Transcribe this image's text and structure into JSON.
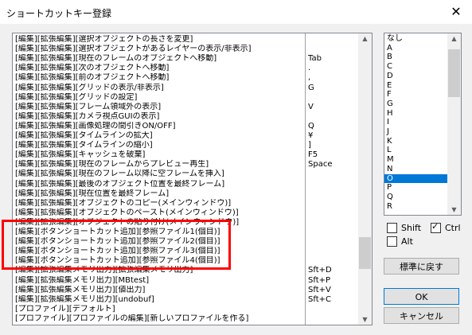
{
  "window": {
    "title": "ショートカットキー登録",
    "close_glyph": "✕"
  },
  "commands": [
    {
      "name": "[編集][拡張編集][選択オブジェクトの長さを変更]",
      "key": ""
    },
    {
      "name": "[編集][拡張編集][選択オブジェクトがあるレイヤーの表示/非表示]",
      "key": ""
    },
    {
      "name": "[編集][拡張編集][現在のフレームのオブジェクトへ移動]",
      "key": "Tab"
    },
    {
      "name": "[編集][拡張編集][次のオブジェクトへ移動]",
      "key": "."
    },
    {
      "name": "[編集][拡張編集][前のオブジェクトへ移動]",
      "key": ","
    },
    {
      "name": "[編集][拡張編集][グリッドの表示/非表示]",
      "key": "G"
    },
    {
      "name": "[編集][拡張編集][グリッドの設定]",
      "key": ""
    },
    {
      "name": "[編集][拡張編集][フレーム領域外の表示]",
      "key": "V"
    },
    {
      "name": "[編集][拡張編集][カメラ視点GUIの表示]",
      "key": ""
    },
    {
      "name": "[編集][拡張編集][画像処理の間引きON/OFF]",
      "key": "Q"
    },
    {
      "name": "[編集][拡張編集][タイムラインの拡大]",
      "key": "¥"
    },
    {
      "name": "[編集][拡張編集][タイムラインの縮小]",
      "key": "]"
    },
    {
      "name": "[編集][拡張編集][キャッシュを破棄]",
      "key": "F5"
    },
    {
      "name": "[編集][拡張編集][現在のフレームからプレビュー再生]",
      "key": "Space"
    },
    {
      "name": "[編集][拡張編集][現在のフレーム以降に空フレームを挿入]",
      "key": ""
    },
    {
      "name": "[編集][拡張編集][最後のオブジェクト位置を最終フレーム]",
      "key": ""
    },
    {
      "name": "[編集][拡張編集][現在位置を最終フレーム]",
      "key": ""
    },
    {
      "name": "[編集][拡張編集][オブジェクトのコピー(メインウィンドウ)]",
      "key": ""
    },
    {
      "name": "[編集][拡張編集][オブジェクトのペースト(メインウィンドウ)]",
      "key": ""
    },
    {
      "name": "[編集][拡張編集][オブジェクトの貼り付け(メインウィンドウ)]",
      "key": ""
    },
    {
      "name": "[編集][ボタンショートカット追加][参照ファイル1(個目)]",
      "key": ""
    },
    {
      "name": "[編集][ボタンショートカット追加][参照ファイル2(個目)]",
      "key": ""
    },
    {
      "name": "[編集][ボタンショートカット追加][参照ファイル3(個目)]",
      "key": ""
    },
    {
      "name": "[編集][ボタンショートカット追加][参照ファイル4(個目)]",
      "key": ""
    },
    {
      "name": "[編集][拡張編集メモリ出力][拡張編集メモリ出力]",
      "key": "Sft+D"
    },
    {
      "name": "[編集][拡張編集メモリ出力][MBtest]",
      "key": "Sft+P"
    },
    {
      "name": "[編集][拡張編集メモリ出力][値出力]",
      "key": "Sft+V"
    },
    {
      "name": "[編集][拡張編集メモリ出力][undobuf]",
      "key": "Sft+C"
    },
    {
      "name": "[プロファイル][デフォルト]",
      "key": ""
    },
    {
      "name": "[プロファイル][プロファイルの編集][新しいプロファイルを作る]",
      "key": ""
    }
  ],
  "keys": [
    "なし",
    "A",
    "B",
    "C",
    "D",
    "E",
    "F",
    "G",
    "H",
    "I",
    "J",
    "K",
    "L",
    "M",
    "N",
    "O",
    "P",
    "Q",
    "R"
  ],
  "selected_key": "O",
  "modifiers": {
    "shift": {
      "label": "Shift",
      "checked": false
    },
    "ctrl": {
      "label": "Ctrl",
      "checked": true
    },
    "alt": {
      "label": "Alt",
      "checked": false
    }
  },
  "buttons": {
    "reset": "標準に戻す",
    "ok": "OK",
    "cancel": "キャンセル"
  }
}
